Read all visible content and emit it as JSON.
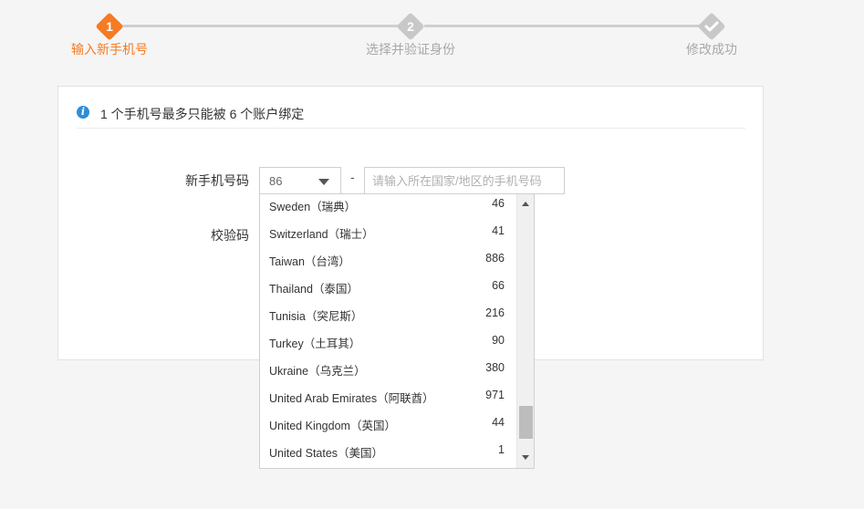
{
  "steps": [
    {
      "num": "1",
      "label": "输入新手机号"
    },
    {
      "num": "2",
      "label": "选择并验证身份"
    },
    {
      "num": "",
      "label": "修改成功"
    }
  ],
  "colors": {
    "active": "#f57b24",
    "inactive": "#c8c8c8",
    "info": "#2d8ed8"
  },
  "notice": {
    "icon": "info-icon",
    "text": "1 个手机号最多只能被 6 个账户绑定"
  },
  "form": {
    "phone_label": "新手机号码",
    "code_label": "校验码",
    "country_code_value": "86",
    "dash": "-",
    "phone_placeholder": "请输入所在国家/地区的手机号码"
  },
  "dropdown": {
    "items": [
      {
        "name": "Sweden（瑞典）",
        "code": "46"
      },
      {
        "name": "Switzerland（瑞士）",
        "code": "41"
      },
      {
        "name": "Taiwan（台湾）",
        "code": "886"
      },
      {
        "name": "Thailand（泰国）",
        "code": "66"
      },
      {
        "name": "Tunisia（突尼斯）",
        "code": "216"
      },
      {
        "name": "Turkey（土耳其）",
        "code": "90"
      },
      {
        "name": "Ukraine（乌克兰）",
        "code": "380"
      },
      {
        "name": "United Arab Emirates（阿联酋）",
        "code": "971"
      },
      {
        "name": "United Kingdom（英国）",
        "code": "44"
      },
      {
        "name": "United States（美国）",
        "code": "1"
      }
    ]
  }
}
